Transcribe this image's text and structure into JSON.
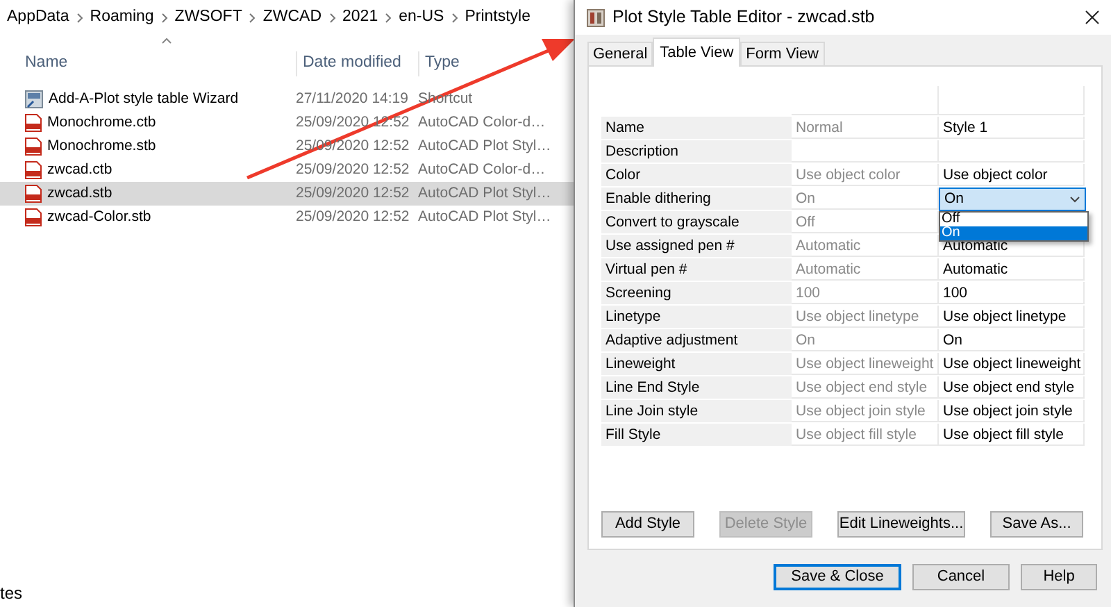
{
  "explorer": {
    "breadcrumb": [
      "AppData",
      "Roaming",
      "ZWSOFT",
      "ZWCAD",
      "2021",
      "en-US",
      "Printstyle"
    ],
    "columns": [
      "Name",
      "Date modified",
      "Type"
    ],
    "files": [
      {
        "name": "Add-A-Plot style table Wizard",
        "date": "27/11/2020 14:19",
        "type": "Shortcut",
        "kind": "shortcut",
        "selected": false
      },
      {
        "name": "Monochrome.ctb",
        "date": "25/09/2020 12:52",
        "type": "AutoCAD Color-d…",
        "kind": "table",
        "selected": false
      },
      {
        "name": "Monochrome.stb",
        "date": "25/09/2020 12:52",
        "type": "AutoCAD Plot Styl…",
        "kind": "table",
        "selected": false
      },
      {
        "name": "zwcad.ctb",
        "date": "25/09/2020 12:52",
        "type": "AutoCAD Color-d…",
        "kind": "table",
        "selected": false
      },
      {
        "name": "zwcad.stb",
        "date": "25/09/2020 12:52",
        "type": "AutoCAD Plot Styl…",
        "kind": "table",
        "selected": true
      },
      {
        "name": "zwcad-Color.stb",
        "date": "25/09/2020 12:52",
        "type": "AutoCAD Plot Styl…",
        "kind": "table",
        "selected": false
      }
    ],
    "status_text": "tes"
  },
  "dialog": {
    "title": "Plot Style Table Editor - zwcad.stb",
    "tabs": [
      {
        "label": "General",
        "selected": false
      },
      {
        "label": "Table View",
        "selected": true
      },
      {
        "label": "Form View",
        "selected": false
      }
    ],
    "rows": [
      {
        "label": "Name",
        "col_2": "Normal",
        "col_3": "Style 1",
        "kind": "text"
      },
      {
        "label": "Description",
        "kind": "text"
      },
      {
        "label": "Color",
        "col_2": "Use object color",
        "col_3": "Use object color",
        "kind": "text"
      },
      {
        "label": "Enable dithering",
        "col_2": "On",
        "col_3": "On",
        "kind": "dropdown",
        "options": [
          {
            "label": "Off",
            "selected": false
          },
          {
            "label": "On",
            "selected": true
          }
        ]
      },
      {
        "label": "Convert to grayscale",
        "col_2": "Off",
        "kind": "text"
      },
      {
        "label": "Use assigned pen #",
        "col_2": "Automatic",
        "col_3": "Automatic",
        "kind": "text"
      },
      {
        "label": "Virtual pen #",
        "col_2": "Automatic",
        "col_3": "Automatic",
        "kind": "text"
      },
      {
        "label": "Screening",
        "col_2": "100",
        "col_3": "100",
        "kind": "text"
      },
      {
        "label": "Linetype",
        "col_2": "Use object linetype",
        "col_3": "Use object linetype",
        "kind": "text"
      },
      {
        "label": "Adaptive adjustment",
        "col_2": "On",
        "col_3": "On",
        "kind": "text"
      },
      {
        "label": "Lineweight",
        "col_2": "Use object lineweight",
        "col_3": "Use object lineweight",
        "kind": "text"
      },
      {
        "label": "Line End Style",
        "col_2": "Use object end style",
        "col_3": "Use object end style",
        "kind": "text"
      },
      {
        "label": "Line Join style",
        "col_2": "Use object join style",
        "col_3": "Use object join style",
        "kind": "text"
      },
      {
        "label": "Fill Style",
        "col_2": "Use object fill style",
        "col_3": "Use object fill style",
        "kind": "text"
      }
    ],
    "buttons": [
      {
        "label": "Add Style",
        "disabled": false
      },
      {
        "label": "Delete Style",
        "disabled": true
      },
      {
        "label": "Edit Lineweights...",
        "disabled": false
      },
      {
        "label": "Save As...",
        "disabled": false
      }
    ],
    "footer_buttons": [
      {
        "label": "Save & Close",
        "default": true
      },
      {
        "label": "Cancel",
        "default": false
      },
      {
        "label": "Help",
        "default": false
      }
    ]
  }
}
